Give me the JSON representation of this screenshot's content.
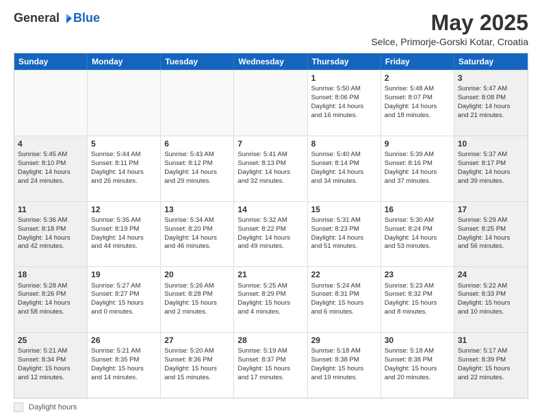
{
  "logo": {
    "general": "General",
    "blue": "Blue"
  },
  "header": {
    "title": "May 2025",
    "subtitle": "Selce, Primorje-Gorski Kotar, Croatia"
  },
  "legend": {
    "label": "Daylight hours"
  },
  "days_of_week": [
    "Sunday",
    "Monday",
    "Tuesday",
    "Wednesday",
    "Thursday",
    "Friday",
    "Saturday"
  ],
  "weeks": [
    [
      {
        "day": "",
        "empty": true
      },
      {
        "day": "",
        "empty": true
      },
      {
        "day": "",
        "empty": true
      },
      {
        "day": "",
        "empty": true
      },
      {
        "day": "1",
        "lines": [
          "Sunrise: 5:50 AM",
          "Sunset: 8:06 PM",
          "Daylight: 14 hours",
          "and 16 minutes."
        ]
      },
      {
        "day": "2",
        "lines": [
          "Sunrise: 5:48 AM",
          "Sunset: 8:07 PM",
          "Daylight: 14 hours",
          "and 18 minutes."
        ]
      },
      {
        "day": "3",
        "shaded": true,
        "lines": [
          "Sunrise: 5:47 AM",
          "Sunset: 8:08 PM",
          "Daylight: 14 hours",
          "and 21 minutes."
        ]
      }
    ],
    [
      {
        "day": "4",
        "shaded": true,
        "lines": [
          "Sunrise: 5:45 AM",
          "Sunset: 8:10 PM",
          "Daylight: 14 hours",
          "and 24 minutes."
        ]
      },
      {
        "day": "5",
        "lines": [
          "Sunrise: 5:44 AM",
          "Sunset: 8:11 PM",
          "Daylight: 14 hours",
          "and 26 minutes."
        ]
      },
      {
        "day": "6",
        "lines": [
          "Sunrise: 5:43 AM",
          "Sunset: 8:12 PM",
          "Daylight: 14 hours",
          "and 29 minutes."
        ]
      },
      {
        "day": "7",
        "lines": [
          "Sunrise: 5:41 AM",
          "Sunset: 8:13 PM",
          "Daylight: 14 hours",
          "and 32 minutes."
        ]
      },
      {
        "day": "8",
        "lines": [
          "Sunrise: 5:40 AM",
          "Sunset: 8:14 PM",
          "Daylight: 14 hours",
          "and 34 minutes."
        ]
      },
      {
        "day": "9",
        "lines": [
          "Sunrise: 5:39 AM",
          "Sunset: 8:16 PM",
          "Daylight: 14 hours",
          "and 37 minutes."
        ]
      },
      {
        "day": "10",
        "shaded": true,
        "lines": [
          "Sunrise: 5:37 AM",
          "Sunset: 8:17 PM",
          "Daylight: 14 hours",
          "and 39 minutes."
        ]
      }
    ],
    [
      {
        "day": "11",
        "shaded": true,
        "lines": [
          "Sunrise: 5:36 AM",
          "Sunset: 8:18 PM",
          "Daylight: 14 hours",
          "and 42 minutes."
        ]
      },
      {
        "day": "12",
        "lines": [
          "Sunrise: 5:35 AM",
          "Sunset: 8:19 PM",
          "Daylight: 14 hours",
          "and 44 minutes."
        ]
      },
      {
        "day": "13",
        "lines": [
          "Sunrise: 5:34 AM",
          "Sunset: 8:20 PM",
          "Daylight: 14 hours",
          "and 46 minutes."
        ]
      },
      {
        "day": "14",
        "lines": [
          "Sunrise: 5:32 AM",
          "Sunset: 8:22 PM",
          "Daylight: 14 hours",
          "and 49 minutes."
        ]
      },
      {
        "day": "15",
        "lines": [
          "Sunrise: 5:31 AM",
          "Sunset: 8:23 PM",
          "Daylight: 14 hours",
          "and 51 minutes."
        ]
      },
      {
        "day": "16",
        "lines": [
          "Sunrise: 5:30 AM",
          "Sunset: 8:24 PM",
          "Daylight: 14 hours",
          "and 53 minutes."
        ]
      },
      {
        "day": "17",
        "shaded": true,
        "lines": [
          "Sunrise: 5:29 AM",
          "Sunset: 8:25 PM",
          "Daylight: 14 hours",
          "and 56 minutes."
        ]
      }
    ],
    [
      {
        "day": "18",
        "shaded": true,
        "lines": [
          "Sunrise: 5:28 AM",
          "Sunset: 8:26 PM",
          "Daylight: 14 hours",
          "and 58 minutes."
        ]
      },
      {
        "day": "19",
        "lines": [
          "Sunrise: 5:27 AM",
          "Sunset: 8:27 PM",
          "Daylight: 15 hours",
          "and 0 minutes."
        ]
      },
      {
        "day": "20",
        "lines": [
          "Sunrise: 5:26 AM",
          "Sunset: 8:28 PM",
          "Daylight: 15 hours",
          "and 2 minutes."
        ]
      },
      {
        "day": "21",
        "lines": [
          "Sunrise: 5:25 AM",
          "Sunset: 8:29 PM",
          "Daylight: 15 hours",
          "and 4 minutes."
        ]
      },
      {
        "day": "22",
        "lines": [
          "Sunrise: 5:24 AM",
          "Sunset: 8:31 PM",
          "Daylight: 15 hours",
          "and 6 minutes."
        ]
      },
      {
        "day": "23",
        "lines": [
          "Sunrise: 5:23 AM",
          "Sunset: 8:32 PM",
          "Daylight: 15 hours",
          "and 8 minutes."
        ]
      },
      {
        "day": "24",
        "shaded": true,
        "lines": [
          "Sunrise: 5:22 AM",
          "Sunset: 8:33 PM",
          "Daylight: 15 hours",
          "and 10 minutes."
        ]
      }
    ],
    [
      {
        "day": "25",
        "shaded": true,
        "lines": [
          "Sunrise: 5:21 AM",
          "Sunset: 8:34 PM",
          "Daylight: 15 hours",
          "and 12 minutes."
        ]
      },
      {
        "day": "26",
        "lines": [
          "Sunrise: 5:21 AM",
          "Sunset: 8:35 PM",
          "Daylight: 15 hours",
          "and 14 minutes."
        ]
      },
      {
        "day": "27",
        "lines": [
          "Sunrise: 5:20 AM",
          "Sunset: 8:36 PM",
          "Daylight: 15 hours",
          "and 15 minutes."
        ]
      },
      {
        "day": "28",
        "lines": [
          "Sunrise: 5:19 AM",
          "Sunset: 8:37 PM",
          "Daylight: 15 hours",
          "and 17 minutes."
        ]
      },
      {
        "day": "29",
        "lines": [
          "Sunrise: 5:18 AM",
          "Sunset: 8:38 PM",
          "Daylight: 15 hours",
          "and 19 minutes."
        ]
      },
      {
        "day": "30",
        "lines": [
          "Sunrise: 5:18 AM",
          "Sunset: 8:38 PM",
          "Daylight: 15 hours",
          "and 20 minutes."
        ]
      },
      {
        "day": "31",
        "shaded": true,
        "lines": [
          "Sunrise: 5:17 AM",
          "Sunset: 8:39 PM",
          "Daylight: 15 hours",
          "and 22 minutes."
        ]
      }
    ]
  ]
}
